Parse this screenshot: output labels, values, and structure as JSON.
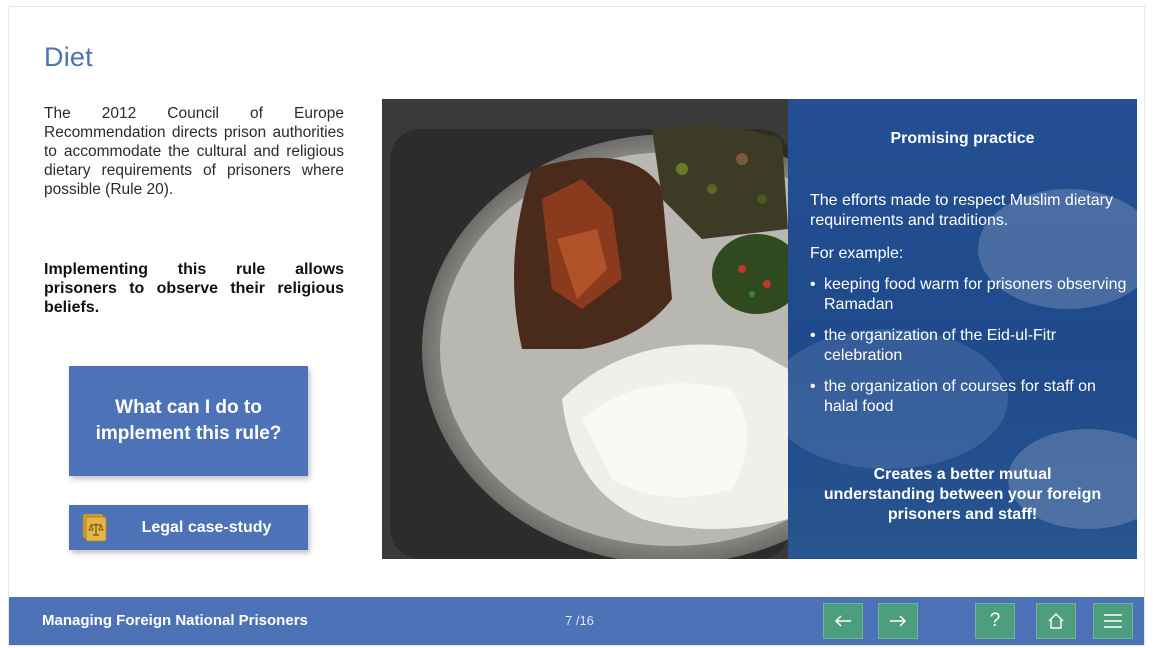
{
  "slide": {
    "title": "Diet",
    "intro": "The 2012 Council of Europe Recommendation directs prison authorities to accommodate the cultural and religious dietary requirements of prisoners where possible (Rule 20).",
    "intro_bold": "Implementing this rule allows prisoners to observe their religious beliefs."
  },
  "buttons": {
    "rule_label": "What can I do to implement this rule?",
    "legal_label": "Legal case-study"
  },
  "panel": {
    "title": "Promising practice",
    "description": "The efforts made to respect Muslim dietary requirements and traditions.",
    "example_intro": "For example:",
    "items": [
      "keeping food warm for prisoners observing Ramadan",
      "the organization of the Eid-ul-Fitr celebration",
      "the organization of courses for staff on halal food"
    ],
    "conclusion": "Creates a better mutual understanding between your foreign prisoners and staff!"
  },
  "footer": {
    "course_title": "Managing Foreign National Prisoners",
    "page_indicator": "7 /16",
    "icons": {
      "prev": "arrow-left-icon",
      "next": "arrow-right-icon",
      "help": "question-icon",
      "home": "home-icon",
      "menu": "menu-icon"
    }
  },
  "colors": {
    "accent": "#4e72b8",
    "nav_button": "#4d9d7f",
    "panel_bg": "#244f92"
  }
}
